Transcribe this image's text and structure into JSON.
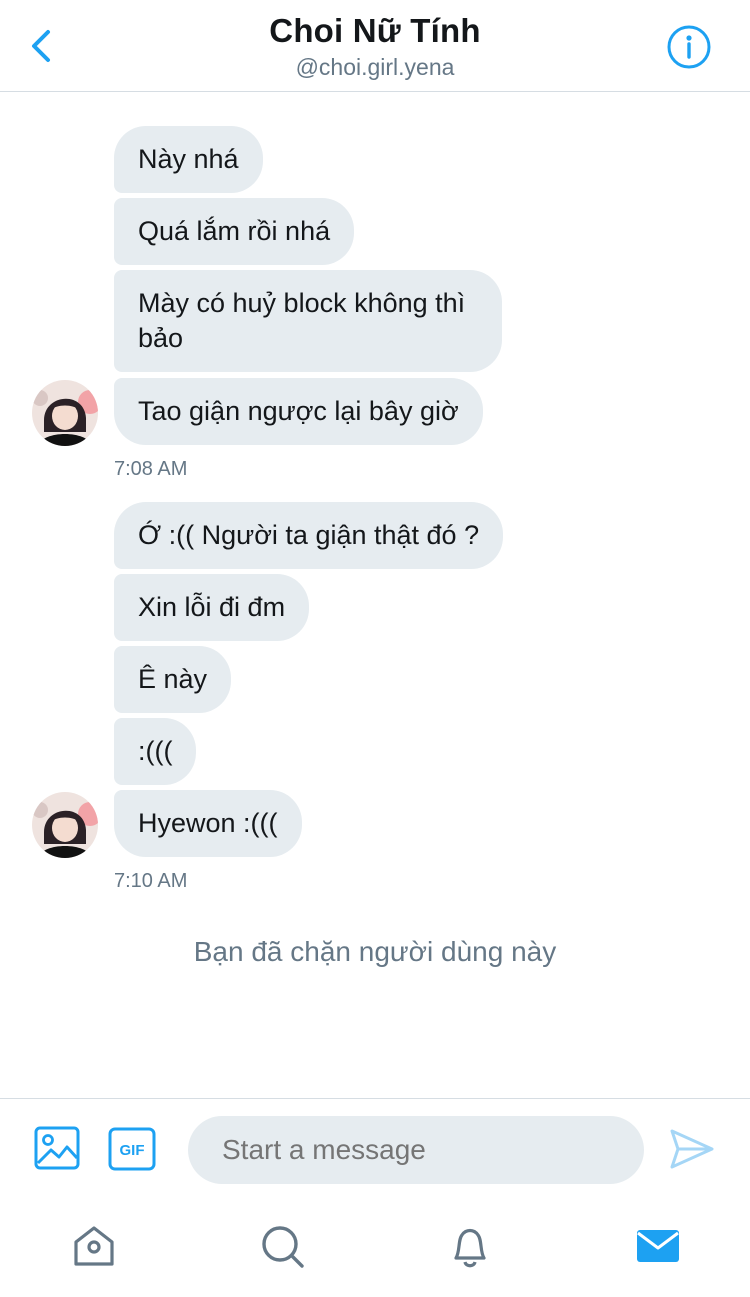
{
  "header": {
    "title": "Choi Nữ Tính",
    "handle": "@choi.girl.yena",
    "back_icon": "chevron-left-icon",
    "info_icon": "info-icon"
  },
  "colors": {
    "accent": "#1da1f2",
    "bubble": "#e6ecf0",
    "secondary_text": "#657786"
  },
  "groups": [
    {
      "messages": [
        "Này nhá",
        "Quá lắm rồi nhá",
        "Mày có huỷ block không thì bảo",
        "Tao giận ngược lại bây giờ"
      ],
      "time": "7:08 AM"
    },
    {
      "messages": [
        "Ớ :(( Người ta giận thật đó ?",
        "Xin lỗi đi đm",
        "Ê này",
        ":(((",
        "Hyewon :((("
      ],
      "time": "7:10 AM"
    }
  ],
  "blocked_notice": "Bạn đã chặn người dùng này",
  "composer": {
    "placeholder": "Start a message",
    "gif_label": "GIF",
    "image_icon": "image-icon",
    "send_icon": "send-icon"
  },
  "tabs": [
    {
      "name": "home",
      "icon": "home-icon",
      "active": false
    },
    {
      "name": "search",
      "icon": "search-icon",
      "active": false
    },
    {
      "name": "notifications",
      "icon": "bell-icon",
      "active": false
    },
    {
      "name": "messages",
      "icon": "mail-icon",
      "active": true
    }
  ]
}
